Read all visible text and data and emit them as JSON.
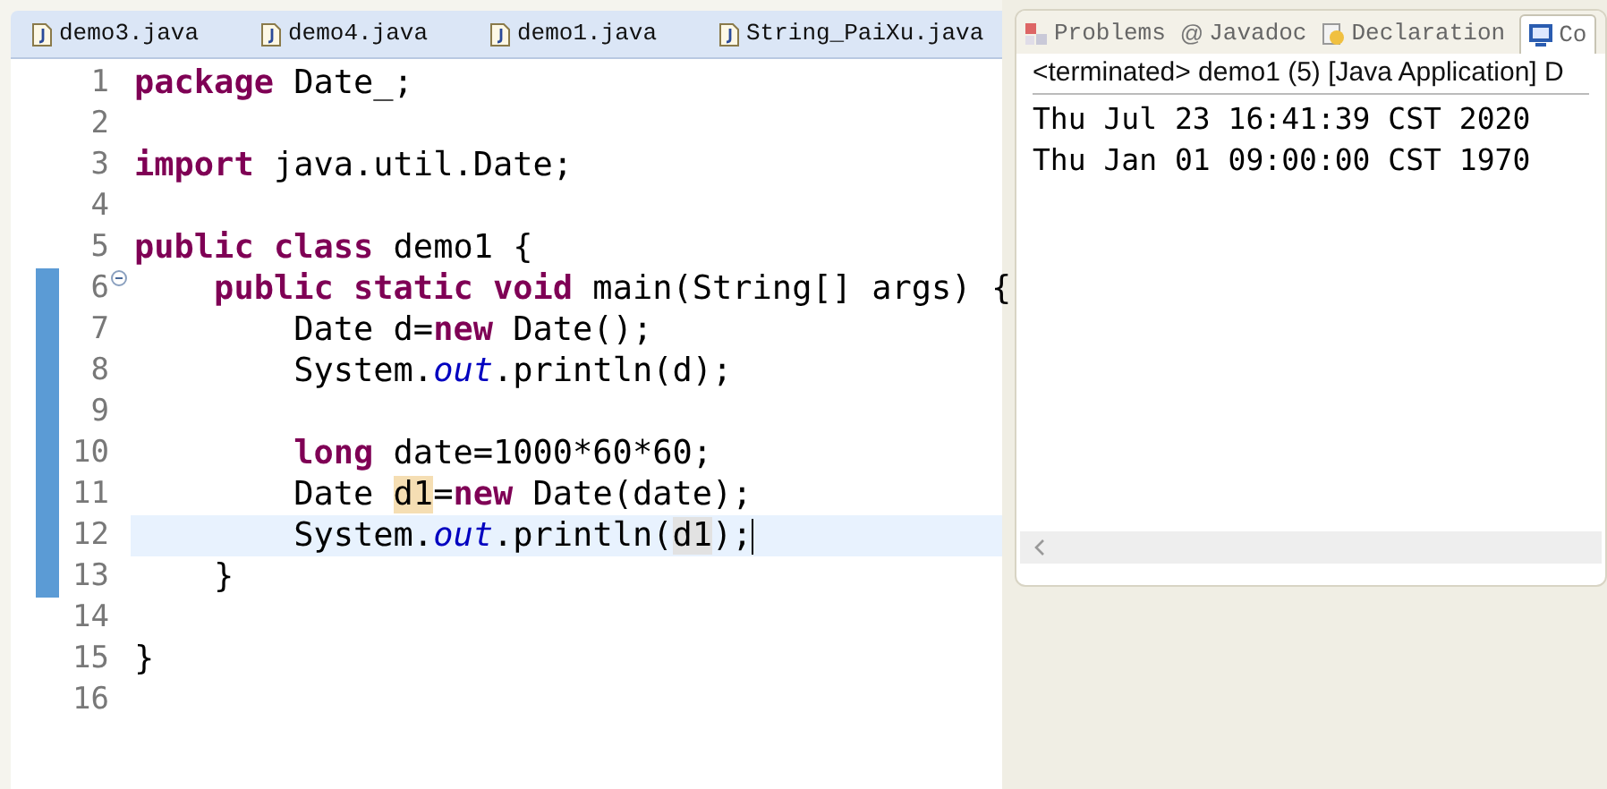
{
  "editor": {
    "tabs": [
      {
        "label": "demo3.java"
      },
      {
        "label": "demo4.java"
      },
      {
        "label": "demo1.java"
      },
      {
        "label": "String_PaiXu.java"
      }
    ],
    "lines": [
      {
        "number": "1",
        "changed": false,
        "current": false,
        "fold": false,
        "tokens": [
          {
            "kind": "keyword",
            "text": "package"
          },
          {
            "kind": "plain",
            "text": " Date_;"
          }
        ]
      },
      {
        "number": "2",
        "changed": false,
        "current": false,
        "fold": false
      },
      {
        "number": "3",
        "changed": false,
        "current": false,
        "fold": false,
        "tokens": [
          {
            "kind": "keyword",
            "text": "import"
          },
          {
            "kind": "plain",
            "text": " java.util.Date;"
          }
        ]
      },
      {
        "number": "4",
        "changed": false,
        "current": false,
        "fold": false
      },
      {
        "number": "5",
        "changed": false,
        "current": false,
        "fold": false,
        "tokens": [
          {
            "kind": "keyword",
            "text": "public class"
          },
          {
            "kind": "plain",
            "text": " demo1 {"
          }
        ]
      },
      {
        "number": "6",
        "changed": true,
        "current": false,
        "fold": true,
        "tokens": [
          {
            "kind": "keyword",
            "text": "    public static void"
          },
          {
            "kind": "plain",
            "text": " main(String[] args) {"
          }
        ]
      },
      {
        "number": "7",
        "changed": true,
        "current": false,
        "fold": false,
        "tokens": [
          {
            "kind": "plain",
            "text": "        Date d="
          },
          {
            "kind": "keyword",
            "text": "new"
          },
          {
            "kind": "plain",
            "text": " Date();"
          }
        ]
      },
      {
        "number": "8",
        "changed": true,
        "current": false,
        "fold": false,
        "tokens": [
          {
            "kind": "plain",
            "text": "        System."
          },
          {
            "kind": "field",
            "text": "out"
          },
          {
            "kind": "plain",
            "text": ".println(d);"
          }
        ]
      },
      {
        "number": "9",
        "changed": true,
        "current": false,
        "fold": false
      },
      {
        "number": "10",
        "changed": true,
        "current": false,
        "fold": false,
        "tokens": [
          {
            "kind": "keyword",
            "text": "        long"
          },
          {
            "kind": "plain",
            "text": " date=1000*60*60;"
          }
        ]
      },
      {
        "number": "11",
        "changed": true,
        "current": false,
        "fold": false,
        "tokens": [
          {
            "kind": "plain",
            "text": "        Date "
          },
          {
            "kind": "occurrence",
            "text": "d1"
          },
          {
            "kind": "plain",
            "text": "="
          },
          {
            "kind": "keyword",
            "text": "new"
          },
          {
            "kind": "plain",
            "text": " Date(date);"
          }
        ]
      },
      {
        "number": "12",
        "changed": true,
        "current": true,
        "fold": false,
        "tokens": [
          {
            "kind": "plain",
            "text": "        System."
          },
          {
            "kind": "field",
            "text": "out"
          },
          {
            "kind": "plain",
            "text": ".println("
          },
          {
            "kind": "read",
            "text": "d1"
          },
          {
            "kind": "plain",
            "text": ");"
          }
        ]
      },
      {
        "number": "13",
        "changed": true,
        "current": false,
        "fold": false,
        "tokens": [
          {
            "kind": "plain",
            "text": "    }"
          }
        ]
      },
      {
        "number": "14",
        "changed": false,
        "current": false,
        "fold": false
      },
      {
        "number": "15",
        "changed": false,
        "current": false,
        "fold": false,
        "tokens": [
          {
            "kind": "plain",
            "text": "}"
          }
        ]
      },
      {
        "number": "16",
        "changed": false,
        "current": false,
        "fold": false
      }
    ]
  },
  "console": {
    "tabs": [
      {
        "label": "Problems",
        "kind": "problems",
        "selected": false
      },
      {
        "label": "Javadoc",
        "kind": "javadoc",
        "icon": "@",
        "selected": false
      },
      {
        "label": "Declaration",
        "kind": "declaration",
        "selected": false
      },
      {
        "label": "Co",
        "kind": "console",
        "selected": true
      }
    ],
    "header": "<terminated> demo1 (5) [Java Application] D",
    "output": [
      "Thu Jul 23 16:41:39 CST 2020",
      "Thu Jan 01 09:00:00 CST 1970"
    ]
  }
}
